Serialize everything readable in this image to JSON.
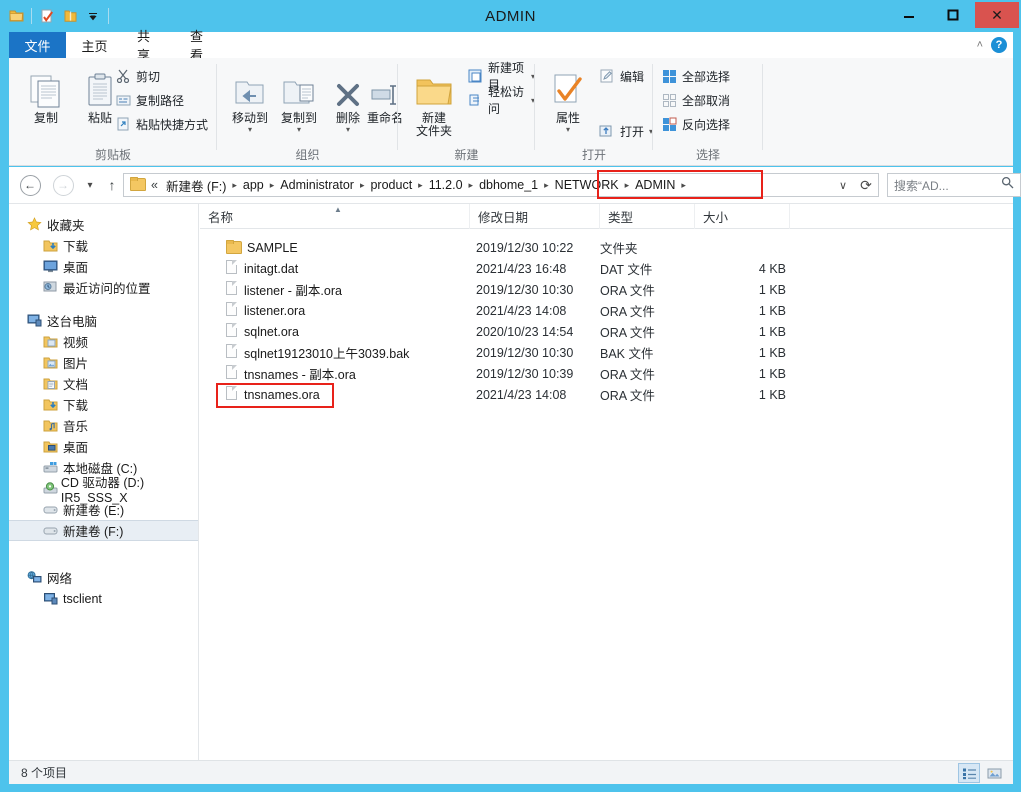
{
  "window": {
    "title": "ADMIN",
    "minimize_label": "–",
    "maximize_label": "□",
    "close_label": "✕"
  },
  "quick_access": [
    {
      "name": "folder-icon",
      "glyph": "folder"
    },
    {
      "name": "properties-icon",
      "glyph": "doc-check"
    },
    {
      "name": "new-folder-icon",
      "glyph": "folder"
    },
    {
      "name": "customize-qat-icon",
      "glyph": "caret-down"
    }
  ],
  "tabs": [
    {
      "id": "file",
      "label": "文件"
    },
    {
      "id": "home",
      "label": "主页"
    },
    {
      "id": "share",
      "label": "共享"
    },
    {
      "id": "view",
      "label": "查看"
    }
  ],
  "ribbon": {
    "collapse_icon": "˄",
    "help_icon": "?",
    "groups": [
      {
        "id": "clipboard",
        "label": "剪贴板",
        "big_buttons": [
          {
            "id": "copy",
            "label": "复制"
          },
          {
            "id": "paste",
            "label": "粘贴"
          }
        ],
        "small_buttons": [
          {
            "id": "cut",
            "label": "剪切"
          },
          {
            "id": "copy-path",
            "label": "复制路径"
          },
          {
            "id": "paste-shortcut",
            "label": "粘贴快捷方式"
          }
        ]
      },
      {
        "id": "organize",
        "label": "组织",
        "big_buttons": [
          {
            "id": "move-to",
            "label": "移动到",
            "has_caret": true
          },
          {
            "id": "copy-to",
            "label": "复制到",
            "has_caret": true
          },
          {
            "id": "delete",
            "label": "删除",
            "has_caret": true
          },
          {
            "id": "rename",
            "label": "重命名"
          }
        ],
        "small_buttons": []
      },
      {
        "id": "new",
        "label": "新建",
        "big_buttons": [
          {
            "id": "new-folder",
            "label": "新建\n文件夹"
          }
        ],
        "small_buttons": [
          {
            "id": "new-item",
            "label": "新建项目",
            "has_caret": true
          },
          {
            "id": "easy-access",
            "label": "轻松访问",
            "has_caret": true
          }
        ]
      },
      {
        "id": "open",
        "label": "打开",
        "big_buttons": [
          {
            "id": "properties",
            "label": "属性",
            "has_caret": true
          }
        ],
        "small_buttons": [
          {
            "id": "open",
            "label": "打开",
            "has_caret": true
          },
          {
            "id": "edit",
            "label": "编辑"
          }
        ]
      },
      {
        "id": "select",
        "label": "选择",
        "big_buttons": [],
        "small_buttons": [
          {
            "id": "select-all",
            "label": "全部选择"
          },
          {
            "id": "select-none",
            "label": "全部取消"
          },
          {
            "id": "invert-selection",
            "label": "反向选择"
          }
        ]
      }
    ]
  },
  "address": {
    "back_icon": "←",
    "forward_icon": "→",
    "recent_caret": "▾",
    "up_icon": "↑",
    "leading_chevron": "«",
    "crumbs": [
      "新建卷 (F:)",
      "app",
      "Administrator",
      "product",
      "11.2.0",
      "dbhome_1",
      "NETWORK",
      "ADMIN"
    ],
    "separator": "▸",
    "dropdown_icon": "∨",
    "refresh_icon": "⟳"
  },
  "search": {
    "placeholder": "搜索“AD...",
    "icon": "search-icon"
  },
  "nav_pane": {
    "sections": [
      {
        "id": "favorites",
        "header": {
          "label": "收藏夹",
          "icon": "star-icon"
        },
        "items": [
          {
            "label": "下载",
            "icon": "downloads-icon"
          },
          {
            "label": "桌面",
            "icon": "desktop-icon"
          },
          {
            "label": "最近访问的位置",
            "icon": "recent-places-icon"
          }
        ]
      },
      {
        "id": "this-pc",
        "header": {
          "label": "这台电脑",
          "icon": "computer-icon"
        },
        "items": [
          {
            "label": "视频",
            "icon": "videos-icon"
          },
          {
            "label": "图片",
            "icon": "pictures-icon"
          },
          {
            "label": "文档",
            "icon": "documents-icon"
          },
          {
            "label": "下载",
            "icon": "downloads-icon"
          },
          {
            "label": "音乐",
            "icon": "music-icon"
          },
          {
            "label": "桌面",
            "icon": "desktop-icon"
          },
          {
            "label": "本地磁盘 (C:)",
            "icon": "system-drive-icon"
          },
          {
            "label": "CD 驱动器 (D:) IR5_SSS_X",
            "icon": "cd-drive-icon"
          },
          {
            "label": "新建卷 (E:)",
            "icon": "drive-icon"
          },
          {
            "label": "新建卷 (F:)",
            "icon": "drive-icon",
            "selected": true
          }
        ]
      },
      {
        "id": "network",
        "header": {
          "label": "网络",
          "icon": "network-icon"
        },
        "items": [
          {
            "label": "tsclient",
            "icon": "computer-icon"
          }
        ]
      }
    ]
  },
  "file_list": {
    "columns": [
      {
        "id": "name",
        "label": "名称",
        "sorted": true,
        "sort_dir": "asc"
      },
      {
        "id": "date",
        "label": "修改日期"
      },
      {
        "id": "type",
        "label": "类型"
      },
      {
        "id": "size",
        "label": "大小"
      }
    ],
    "rows": [
      {
        "name": "SAMPLE",
        "date": "2019/12/30 10:22",
        "type": "文件夹",
        "size": "",
        "icon": "folder-icon"
      },
      {
        "name": "initagt.dat",
        "date": "2021/4/23 16:48",
        "type": "DAT 文件",
        "size": "4 KB",
        "icon": "file-icon"
      },
      {
        "name": "listener - 副本.ora",
        "date": "2019/12/30 10:30",
        "type": "ORA 文件",
        "size": "1 KB",
        "icon": "file-icon"
      },
      {
        "name": "listener.ora",
        "date": "2021/4/23 14:08",
        "type": "ORA 文件",
        "size": "1 KB",
        "icon": "file-icon"
      },
      {
        "name": "sqlnet.ora",
        "date": "2020/10/23 14:54",
        "type": "ORA 文件",
        "size": "1 KB",
        "icon": "file-icon"
      },
      {
        "name": "sqlnet19123010上午3039.bak",
        "date": "2019/12/30 10:30",
        "type": "BAK 文件",
        "size": "1 KB",
        "icon": "file-icon"
      },
      {
        "name": "tnsnames - 副本.ora",
        "date": "2019/12/30 10:39",
        "type": "ORA 文件",
        "size": "1 KB",
        "icon": "file-icon"
      },
      {
        "name": "tnsnames.ora",
        "date": "2021/4/23 14:08",
        "type": "ORA 文件",
        "size": "1 KB",
        "icon": "file-icon",
        "highlighted": true
      }
    ]
  },
  "status_bar": {
    "text": "8 个项目",
    "view_buttons": [
      {
        "id": "details-view",
        "label": "details-view-icon",
        "active": true
      },
      {
        "id": "large-icons-view",
        "label": "large-icons-view-icon",
        "active": false
      }
    ]
  },
  "annotations": {
    "highlight_color": "#e8221a",
    "boxes": [
      {
        "target": "address-crumbs-network-admin"
      },
      {
        "target": "file-row-tnsnames-ora"
      }
    ]
  }
}
